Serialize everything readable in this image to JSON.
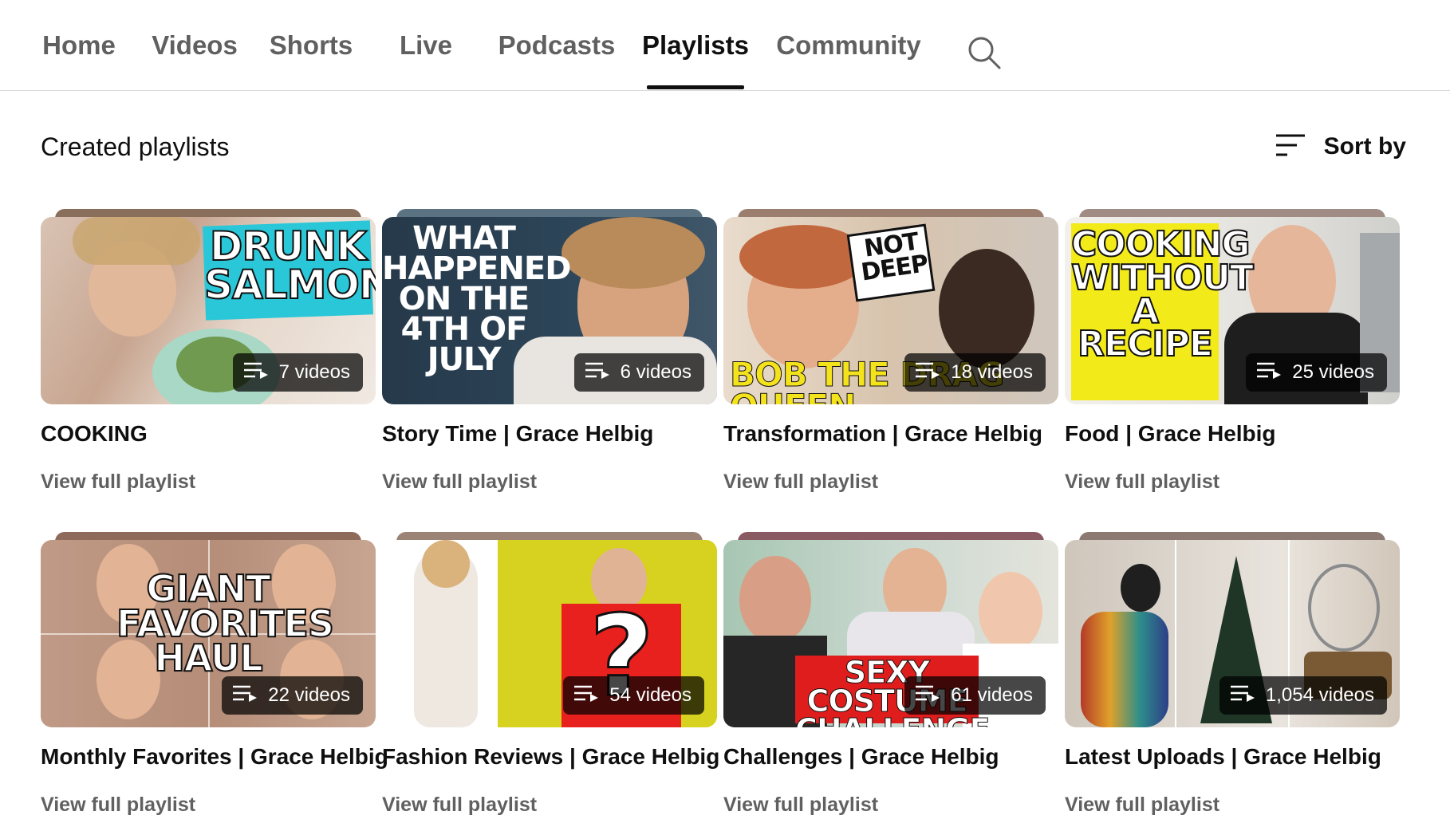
{
  "tabs": [
    {
      "label": "Home",
      "active": false
    },
    {
      "label": "Videos",
      "active": false
    },
    {
      "label": "Shorts",
      "active": false
    },
    {
      "label": "Live",
      "active": false
    },
    {
      "label": "Podcasts",
      "active": false
    },
    {
      "label": "Playlists",
      "active": true
    },
    {
      "label": "Community",
      "active": false
    }
  ],
  "search_icon": "search-icon",
  "section": {
    "title": "Created playlists",
    "sort_label": "Sort by",
    "sort_icon": "sort-icon"
  },
  "playlists": [
    {
      "title": "COOKING",
      "count": "7 videos",
      "link": "View full playlist",
      "thumb_text": "DRUNK SALMON",
      "stack_color": "#8a6e5c"
    },
    {
      "title": "Story Time | Grace Helbig",
      "count": "6 videos",
      "link": "View full playlist",
      "thumb_text": "WHAT HAPPENED ON THE 4TH OF JULY",
      "stack_color": "#5a7281"
    },
    {
      "title": "Transformation | Grace Helbig",
      "count": "18 videos",
      "link": "View full playlist",
      "thumb_text": "NOT TOO DEEP with BOB THE DRAG QUEEN",
      "stack_color": "#9c7e6e"
    },
    {
      "title": "Food | Grace Helbig",
      "count": "25 videos",
      "link": "View full playlist",
      "thumb_text": "COOKING WITHOUT A RECIPE",
      "stack_color": "#a08c84"
    },
    {
      "title": "Monthly Favorites | Grace Helbig",
      "count": "22 videos",
      "link": "View full playlist",
      "thumb_text": "GIANT FAVORITES HAUL",
      "stack_color": "#8e6a5a"
    },
    {
      "title": "Fashion Reviews | Grace Helbig",
      "count": "54 videos",
      "link": "View full playlist",
      "thumb_text": "?",
      "stack_color": "#9b8376"
    },
    {
      "title": "Challenges | Grace Helbig",
      "count": "61 videos",
      "link": "View full playlist",
      "thumb_text": "SEXY COSTUME CHALLENGE",
      "stack_color": "#8a5a62"
    },
    {
      "title": "Latest Uploads | Grace Helbig",
      "count": "1,054 videos",
      "link": "View full playlist",
      "thumb_text": "",
      "stack_color": "#8c7a72"
    }
  ]
}
